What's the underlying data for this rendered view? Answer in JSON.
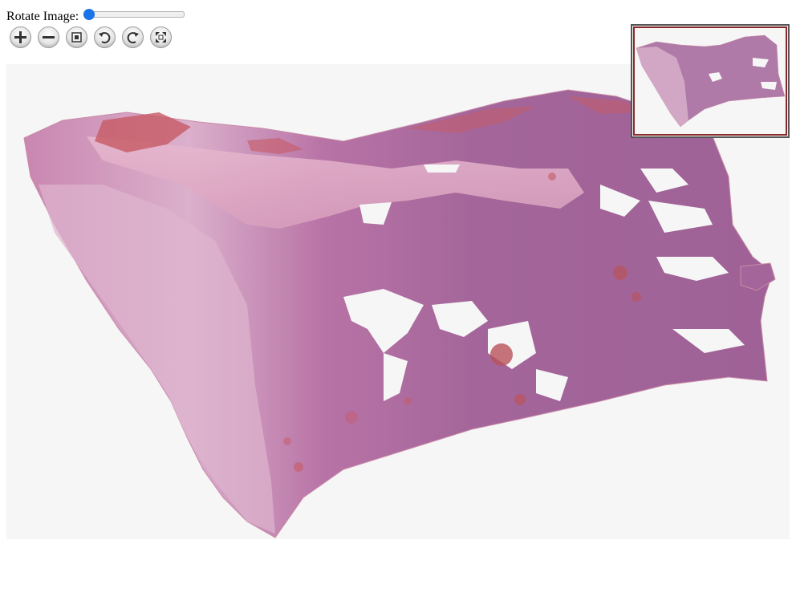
{
  "rotate": {
    "label": "Rotate Image:",
    "value": 0,
    "min": 0,
    "max": 360
  },
  "toolbar": [
    {
      "name": "zoom-in-button",
      "icon": "plus-icon"
    },
    {
      "name": "zoom-out-button",
      "icon": "minus-icon"
    },
    {
      "name": "home-button",
      "icon": "home-icon"
    },
    {
      "name": "rotate-left-button",
      "icon": "rotate-left-icon"
    },
    {
      "name": "rotate-right-button",
      "icon": "rotate-right-icon"
    },
    {
      "name": "fullscreen-button",
      "icon": "fullscreen-icon"
    }
  ],
  "colors": {
    "tissue_light": "#d8a9c8",
    "tissue_dark": "#a4669a",
    "tissue_edge": "#c98aa8",
    "hemorrhage": "#c75a64",
    "navigator_border": "#8b2a2a",
    "slider_thumb": "#1a73e8"
  }
}
